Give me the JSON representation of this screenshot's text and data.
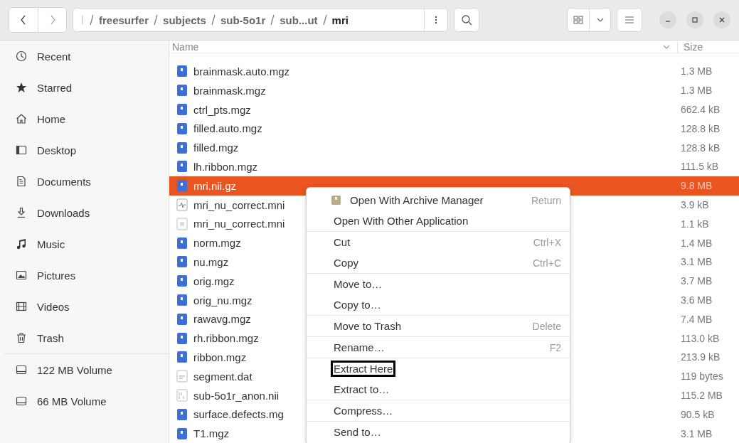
{
  "toolbar": {
    "path": [
      {
        "label": "freesurfer",
        "current": false
      },
      {
        "label": "subjects",
        "current": false
      },
      {
        "label": "sub-5o1r",
        "current": false
      },
      {
        "label": "sub...ut",
        "current": false
      },
      {
        "label": "mri",
        "current": true
      }
    ]
  },
  "sidebar": {
    "items": [
      {
        "label": "Recent"
      },
      {
        "label": "Starred"
      },
      {
        "label": "Home"
      },
      {
        "label": "Desktop"
      },
      {
        "label": "Documents"
      },
      {
        "label": "Downloads"
      },
      {
        "label": "Music"
      },
      {
        "label": "Pictures"
      },
      {
        "label": "Videos"
      },
      {
        "label": "Trash"
      }
    ],
    "volumes": [
      {
        "label": "122 MB Volume"
      },
      {
        "label": "66 MB Volume"
      }
    ]
  },
  "table": {
    "columns": [
      "Name",
      "Size"
    ],
    "rows": [
      {
        "name": "brainmask.auto.mgz",
        "size": "1.3 MB",
        "kind": "image",
        "selected": false
      },
      {
        "name": "brainmask.mgz",
        "size": "1.3 MB",
        "kind": "image",
        "selected": false
      },
      {
        "name": "ctrl_pts.mgz",
        "size": "662.4 kB",
        "kind": "image",
        "selected": false
      },
      {
        "name": "filled.auto.mgz",
        "size": "128.8 kB",
        "kind": "image",
        "selected": false
      },
      {
        "name": "filled.mgz",
        "size": "128.8 kB",
        "kind": "image",
        "selected": false
      },
      {
        "name": "lh.ribbon.mgz",
        "size": "111.5 kB",
        "kind": "image",
        "selected": false
      },
      {
        "name": "mri.nii.gz",
        "size": "9.8 MB",
        "kind": "image",
        "selected": true
      },
      {
        "name": "mri_nu_correct.mni",
        "size": "3.9 kB",
        "kind": "log",
        "selected": false
      },
      {
        "name": "mri_nu_correct.mni",
        "size": "1.1 kB",
        "kind": "blank",
        "selected": false
      },
      {
        "name": "norm.mgz",
        "size": "1.4 MB",
        "kind": "image",
        "selected": false
      },
      {
        "name": "nu.mgz",
        "size": "3.1 MB",
        "kind": "image",
        "selected": false
      },
      {
        "name": "orig.mgz",
        "size": "3.7 MB",
        "kind": "image",
        "selected": false
      },
      {
        "name": "orig_nu.mgz",
        "size": "3.6 MB",
        "kind": "image",
        "selected": false
      },
      {
        "name": "rawavg.mgz",
        "size": "7.4 MB",
        "kind": "image",
        "selected": false
      },
      {
        "name": "rh.ribbon.mgz",
        "size": "113.0 kB",
        "kind": "image",
        "selected": false
      },
      {
        "name": "ribbon.mgz",
        "size": "213.9 kB",
        "kind": "image",
        "selected": false
      },
      {
        "name": "segment.dat",
        "size": "119 bytes",
        "kind": "text",
        "selected": false
      },
      {
        "name": "sub-5o1r_anon.nii",
        "size": "115.2 MB",
        "kind": "binary",
        "selected": false
      },
      {
        "name": "surface.defects.mg",
        "size": "90.5 kB",
        "kind": "image",
        "selected": false
      },
      {
        "name": "T1.mgz",
        "size": "3.1 MB",
        "kind": "image",
        "selected": false
      }
    ]
  },
  "context_menu": {
    "sections": [
      [
        {
          "label": "Open With Archive Manager",
          "shortcut": "Return",
          "kind": "archive",
          "highlighted": false
        },
        {
          "label": "Open With Other Application",
          "highlighted": false
        }
      ],
      [
        {
          "label": "Cut",
          "shortcut": "Ctrl+X",
          "highlighted": false
        },
        {
          "label": "Copy",
          "shortcut": "Ctrl+C",
          "highlighted": false
        }
      ],
      [
        {
          "label": "Move to…",
          "highlighted": false
        },
        {
          "label": "Copy to…",
          "highlighted": false
        }
      ],
      [
        {
          "label": "Move to Trash",
          "shortcut": "Delete",
          "highlighted": false
        }
      ],
      [
        {
          "label": "Rename…",
          "shortcut": "F2",
          "highlighted": false
        }
      ],
      [
        {
          "label": "Extract Here",
          "highlighted": true
        },
        {
          "label": "Extract to…",
          "highlighted": false
        }
      ],
      [
        {
          "label": "Compress…",
          "highlighted": false
        }
      ],
      [
        {
          "label": "Send to…",
          "highlighted": false
        }
      ]
    ]
  }
}
